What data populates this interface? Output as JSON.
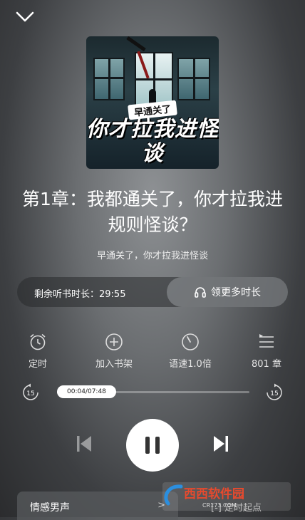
{
  "cover": {
    "badge": "早通关了",
    "title": "你才拉我进怪谈"
  },
  "chapter_title": "第1章：我都通关了，你才拉我进规则怪谈？",
  "book_name": "早通关了，你才拉我进怪谈",
  "remain": {
    "label": "剩余听书时长：29:55",
    "more_button": "领更多时长"
  },
  "tools": [
    {
      "label": "定时",
      "icon": "alarm-clock-icon"
    },
    {
      "label": "加入书架",
      "icon": "plus-circle-icon"
    },
    {
      "label": "语速1.0倍",
      "icon": "speedometer-icon"
    },
    {
      "label": "801 章",
      "icon": "playlist-icon"
    }
  ],
  "progress": {
    "time": "00:04/07:48",
    "fraction": 0.0085,
    "rewind": "15",
    "forward": "15"
  },
  "bottom": {
    "voice": "情感男声",
    "chevron": ">",
    "start_point": "[-] 定时起点"
  },
  "watermark": {
    "text": "西西软件园",
    "url": "CR173.COM"
  }
}
